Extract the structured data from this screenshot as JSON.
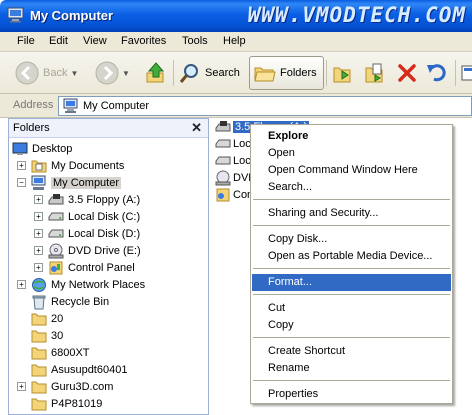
{
  "window": {
    "title": "My Computer",
    "watermark": "WWW.VMODTECH.COM"
  },
  "menu": [
    "File",
    "Edit",
    "View",
    "Favorites",
    "Tools",
    "Help"
  ],
  "toolbar": {
    "back": "Back",
    "search": "Search",
    "folders": "Folders"
  },
  "address": {
    "label": "Address",
    "value": "My Computer"
  },
  "folders_pane": {
    "title": "Folders",
    "items": [
      {
        "label": "Desktop"
      },
      {
        "label": "My Documents"
      },
      {
        "label": "My Computer"
      },
      {
        "label": "3.5 Floppy (A:)"
      },
      {
        "label": "Local Disk (C:)"
      },
      {
        "label": "Local Disk (D:)"
      },
      {
        "label": "DVD Drive (E:)"
      },
      {
        "label": "Control Panel"
      },
      {
        "label": "My Network Places"
      },
      {
        "label": "Recycle Bin"
      },
      {
        "label": "20"
      },
      {
        "label": "30"
      },
      {
        "label": "6800XT"
      },
      {
        "label": "Asusupdt60401"
      },
      {
        "label": "Guru3D.com"
      },
      {
        "label": "P4P81019"
      }
    ]
  },
  "right_pane": {
    "items": [
      {
        "label": "3.5 Floppy (A:)"
      },
      {
        "label": "Local Disk (C:)"
      },
      {
        "label": "Local Disk (D:)"
      },
      {
        "label": "DVD Drive (E:)"
      },
      {
        "label": "Control Panel"
      }
    ]
  },
  "context_menu": {
    "items": [
      "Explore",
      "Open",
      "Open Command Window Here",
      "Search...",
      "Sharing and Security...",
      "Copy Disk...",
      "Open as Portable Media Device...",
      "Format...",
      "Cut",
      "Copy",
      "Create Shortcut",
      "Rename",
      "Properties"
    ],
    "highlighted": "Format..."
  }
}
